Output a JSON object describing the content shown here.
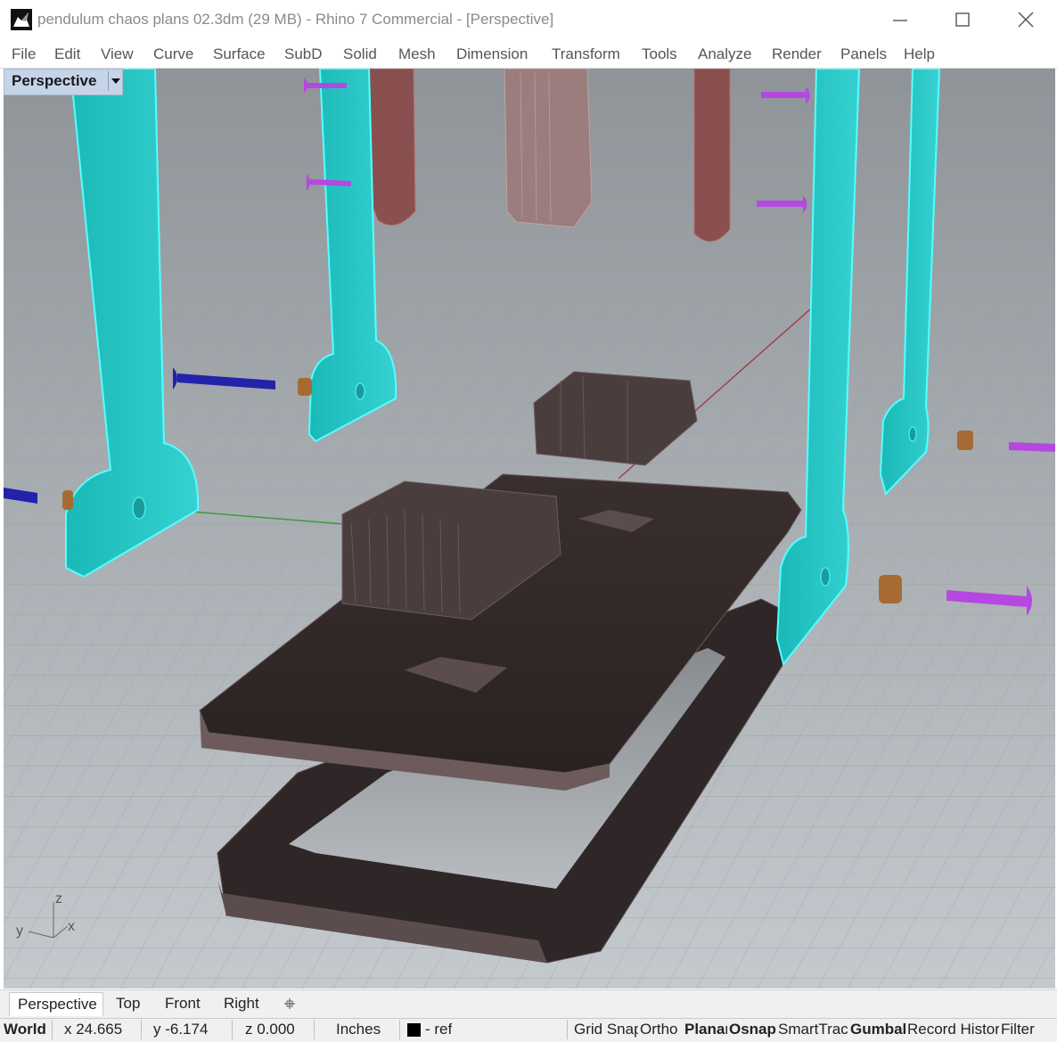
{
  "window": {
    "title": "pendulum chaos plans 02.3dm (29 MB) - Rhino 7 Commercial - [Perspective]",
    "minimize_icon": "minimize-icon",
    "maximize_icon": "maximize-icon",
    "close_icon": "close-icon"
  },
  "menu": [
    "File",
    "Edit",
    "View",
    "Curve",
    "Surface",
    "SubD",
    "Solid",
    "Mesh",
    "Dimension",
    "Transform",
    "Tools",
    "Analyze",
    "Render",
    "Panels",
    "Help"
  ],
  "viewport": {
    "label": "Perspective",
    "axes": {
      "z": "z",
      "y": "y",
      "x": "x"
    },
    "colors": {
      "background_top": "#8f9499",
      "background_bottom": "#c4c9ce",
      "selection": "#3ee0e0",
      "part": "#4a3c3c",
      "fastener": "#b548e0"
    }
  },
  "tabs": [
    "Perspective",
    "Top",
    "Front",
    "Right"
  ],
  "add_tab_icon": "add-viewport-tab-icon",
  "status": {
    "cplane": "World",
    "x": "x 24.665",
    "y": "y -6.174",
    "z": "z 0.000",
    "units": "Inches",
    "layer": "- ref",
    "toggles": [
      "Grid Snap",
      "Ortho",
      "Planar",
      "Osnap",
      "SmartTrack",
      "Gumball",
      "Record History",
      "Filter"
    ],
    "toggles_active": [
      "Planar",
      "Osnap",
      "Gumball"
    ]
  }
}
